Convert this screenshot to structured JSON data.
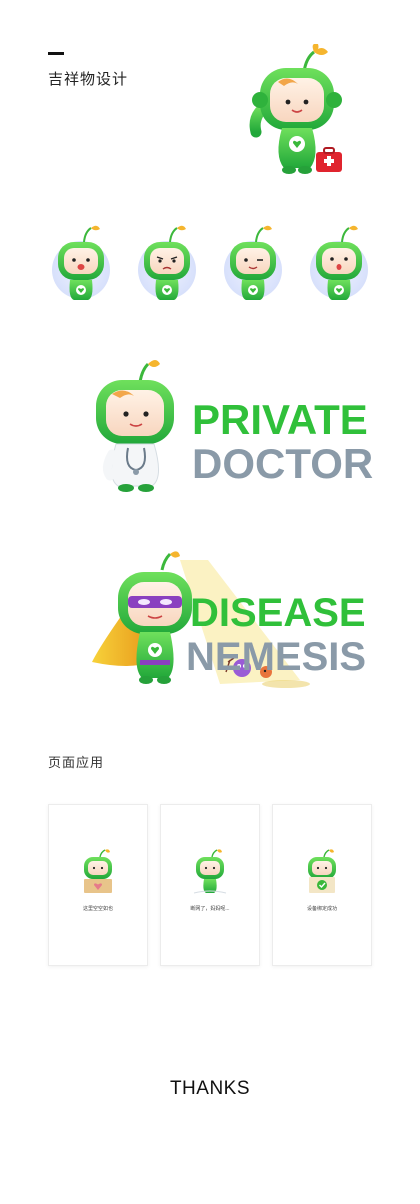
{
  "header": {
    "title": "吉祥物设计"
  },
  "sections": {
    "page_application": "页面应用"
  },
  "banners": {
    "doctor": {
      "line1": "PRIVATE",
      "line2": "DOCTOR"
    },
    "hero": {
      "line1": "DISEASE",
      "line2": "NEMESIS"
    }
  },
  "cards": [
    {
      "caption": "这里空空如也"
    },
    {
      "caption": "断网了，妈妈呢..."
    },
    {
      "caption": "设备绑定成功"
    }
  ],
  "footer": {
    "thanks": "THANKS"
  },
  "colors": {
    "mascot_green": "#3cc63c",
    "text_gray": "#8a9aa8",
    "accent_yellow": "#f5c23a"
  },
  "icons": [
    "mascot-main",
    "first-aid-kit-icon",
    "mascot-expression-avatar",
    "stethoscope-icon",
    "cape-icon",
    "heart-icon",
    "check-icon"
  ]
}
